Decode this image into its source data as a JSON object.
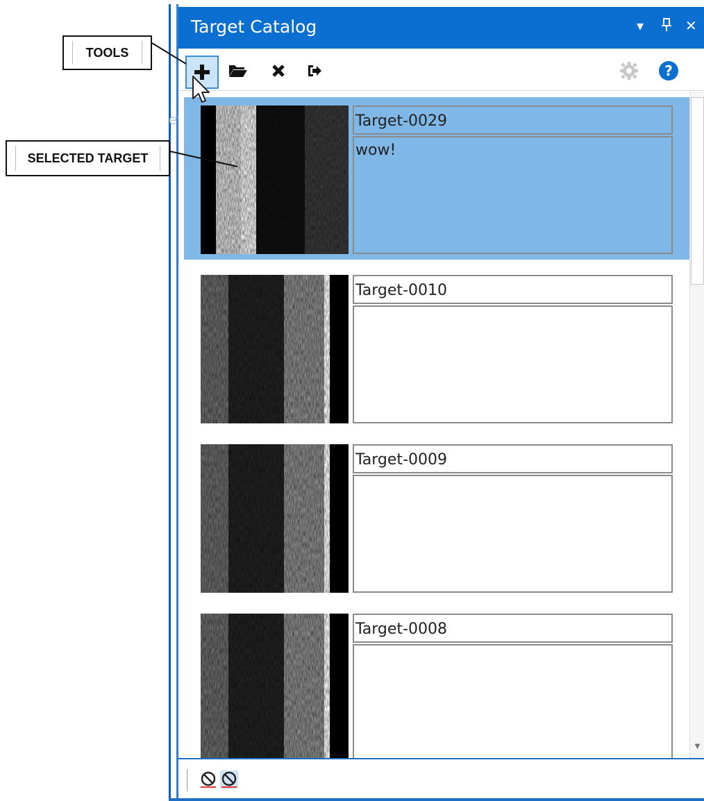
{
  "callouts": {
    "tools": "TOOLS",
    "selected_target": "SELECTED TARGET"
  },
  "panel": {
    "title": "Target Catalog",
    "title_buttons": [
      "dropdown-icon",
      "pin-icon",
      "close-icon"
    ],
    "toolbar": [
      "add-icon",
      "open-folder-icon",
      "delete-icon",
      "export-icon",
      "settings-icon",
      "help-icon"
    ],
    "ghost_text": "ets"
  },
  "targets": [
    {
      "name": "Target-0029",
      "note": "wow!",
      "selected": true
    },
    {
      "name": "Target-0010",
      "note": "",
      "selected": false
    },
    {
      "name": "Target-0009",
      "note": "",
      "selected": false
    },
    {
      "name": "Target-0008",
      "note": "",
      "selected": false
    }
  ],
  "colors": {
    "titlebar": "#0a6fd0",
    "selection": "#7fb7e6"
  },
  "status": [
    "no-entry-icon",
    "no-entry-icon-selected"
  ]
}
